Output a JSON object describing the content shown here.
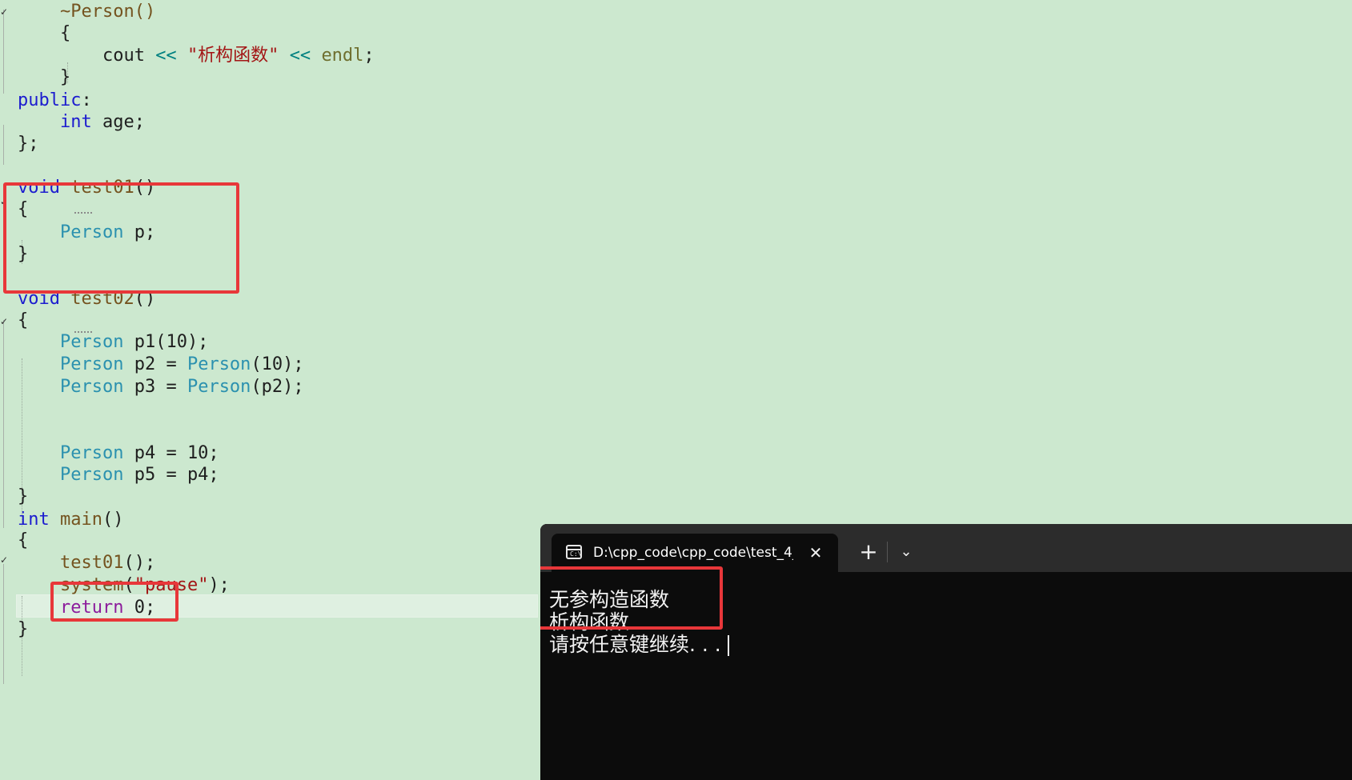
{
  "editor": {
    "lines": [
      {
        "id": "destructor-decl",
        "tokens": [
          {
            "t": "    ~Person()",
            "c": "fn"
          }
        ]
      },
      {
        "id": "brace-open-1",
        "tokens": [
          {
            "t": "    {",
            "c": "var"
          }
        ]
      },
      {
        "id": "cout-line",
        "tokens": [
          {
            "t": "        cout ",
            "c": "var"
          },
          {
            "t": "<<",
            "c": "op"
          },
          {
            "t": " ",
            "c": "var"
          },
          {
            "t": "\"析构函数\"",
            "c": "str"
          },
          {
            "t": " ",
            "c": "var"
          },
          {
            "t": "<<",
            "c": "op"
          },
          {
            "t": " ",
            "c": "var"
          },
          {
            "t": "endl",
            "c": "endl"
          },
          {
            "t": ";",
            "c": "var"
          }
        ]
      },
      {
        "id": "brace-close-1",
        "tokens": [
          {
            "t": "    }",
            "c": "var"
          }
        ]
      },
      {
        "id": "public-label",
        "tokens": [
          {
            "t": "public",
            "c": "kw"
          },
          {
            "t": ":",
            "c": "var"
          }
        ]
      },
      {
        "id": "int-age",
        "tokens": [
          {
            "t": "    ",
            "c": "var"
          },
          {
            "t": "int",
            "c": "kw"
          },
          {
            "t": " age;",
            "c": "var"
          }
        ]
      },
      {
        "id": "class-end",
        "tokens": [
          {
            "t": "};",
            "c": "var"
          }
        ]
      },
      {
        "id": "test01-decl",
        "tokens": [
          {
            "t": "void",
            "c": "kw"
          },
          {
            "t": " ",
            "c": "var"
          },
          {
            "t": "test01",
            "c": "fn"
          },
          {
            "t": "()",
            "c": "var"
          }
        ]
      },
      {
        "id": "test01-open",
        "tokens": [
          {
            "t": "{",
            "c": "var"
          }
        ]
      },
      {
        "id": "test01-body",
        "tokens": [
          {
            "t": "    ",
            "c": "var"
          },
          {
            "t": "Person",
            "c": "type"
          },
          {
            "t": " p;",
            "c": "var"
          }
        ]
      },
      {
        "id": "test01-close",
        "tokens": [
          {
            "t": "}",
            "c": "var"
          }
        ]
      },
      {
        "id": "test02-decl",
        "tokens": [
          {
            "t": "void",
            "c": "kw"
          },
          {
            "t": " ",
            "c": "var"
          },
          {
            "t": "test02",
            "c": "fn"
          },
          {
            "t": "()",
            "c": "var"
          }
        ]
      },
      {
        "id": "test02-open",
        "tokens": [
          {
            "t": "{",
            "c": "var"
          }
        ]
      },
      {
        "id": "p1-line",
        "tokens": [
          {
            "t": "    ",
            "c": "var"
          },
          {
            "t": "Person",
            "c": "type"
          },
          {
            "t": " p1(10);",
            "c": "var"
          }
        ]
      },
      {
        "id": "p2-line",
        "tokens": [
          {
            "t": "    ",
            "c": "var"
          },
          {
            "t": "Person",
            "c": "type"
          },
          {
            "t": " p2 = ",
            "c": "var"
          },
          {
            "t": "Person",
            "c": "type"
          },
          {
            "t": "(10);",
            "c": "var"
          }
        ]
      },
      {
        "id": "p3-line",
        "tokens": [
          {
            "t": "    ",
            "c": "var"
          },
          {
            "t": "Person",
            "c": "type"
          },
          {
            "t": " p3 = ",
            "c": "var"
          },
          {
            "t": "Person",
            "c": "type"
          },
          {
            "t": "(p2);",
            "c": "var"
          }
        ]
      },
      {
        "id": "p4-line",
        "tokens": [
          {
            "t": "    ",
            "c": "var"
          },
          {
            "t": "Person",
            "c": "type"
          },
          {
            "t": " p4 = 10;",
            "c": "var"
          }
        ]
      },
      {
        "id": "p5-line",
        "tokens": [
          {
            "t": "    ",
            "c": "var"
          },
          {
            "t": "Person",
            "c": "type"
          },
          {
            "t": " p5 = p4;",
            "c": "var"
          }
        ]
      },
      {
        "id": "test02-close",
        "tokens": [
          {
            "t": "}",
            "c": "var"
          }
        ]
      },
      {
        "id": "main-decl",
        "tokens": [
          {
            "t": "int",
            "c": "kw"
          },
          {
            "t": " ",
            "c": "var"
          },
          {
            "t": "main",
            "c": "fn"
          },
          {
            "t": "()",
            "c": "var"
          }
        ]
      },
      {
        "id": "main-open",
        "tokens": [
          {
            "t": "{",
            "c": "var"
          }
        ]
      },
      {
        "id": "test01-call",
        "tokens": [
          {
            "t": "    ",
            "c": "var"
          },
          {
            "t": "test01",
            "c": "fn"
          },
          {
            "t": "();",
            "c": "var"
          }
        ]
      },
      {
        "id": "system-call",
        "tokens": [
          {
            "t": "    ",
            "c": "var"
          },
          {
            "t": "system",
            "c": "fn"
          },
          {
            "t": "(",
            "c": "var"
          },
          {
            "t": "\"pause\"",
            "c": "str"
          },
          {
            "t": ");",
            "c": "var"
          }
        ]
      },
      {
        "id": "return-line",
        "tokens": [
          {
            "t": "    ",
            "c": "var"
          },
          {
            "t": "return",
            "c": "ret"
          },
          {
            "t": " 0;",
            "c": "var"
          }
        ]
      },
      {
        "id": "main-close",
        "tokens": [
          {
            "t": "}",
            "c": "var"
          }
        ]
      }
    ]
  },
  "terminal": {
    "tab_title": "D:\\cpp_code\\cpp_code\\test_4_",
    "tab_icon": "terminal-icon",
    "tab_icon_glyph": "C:\\",
    "close_glyph": "✕",
    "new_tab_glyph": "+",
    "dropdown_glyph": "⌄",
    "output": [
      "无参构造函数",
      "析构函数",
      "请按任意键继续. . ."
    ]
  },
  "colors": {
    "editor_bg": "#cce8cf",
    "keyword": "#1c1ccf",
    "type": "#2b91af",
    "string": "#a31515",
    "highlight_border": "#e8373a",
    "terminal_bg": "#0c0c0c"
  }
}
